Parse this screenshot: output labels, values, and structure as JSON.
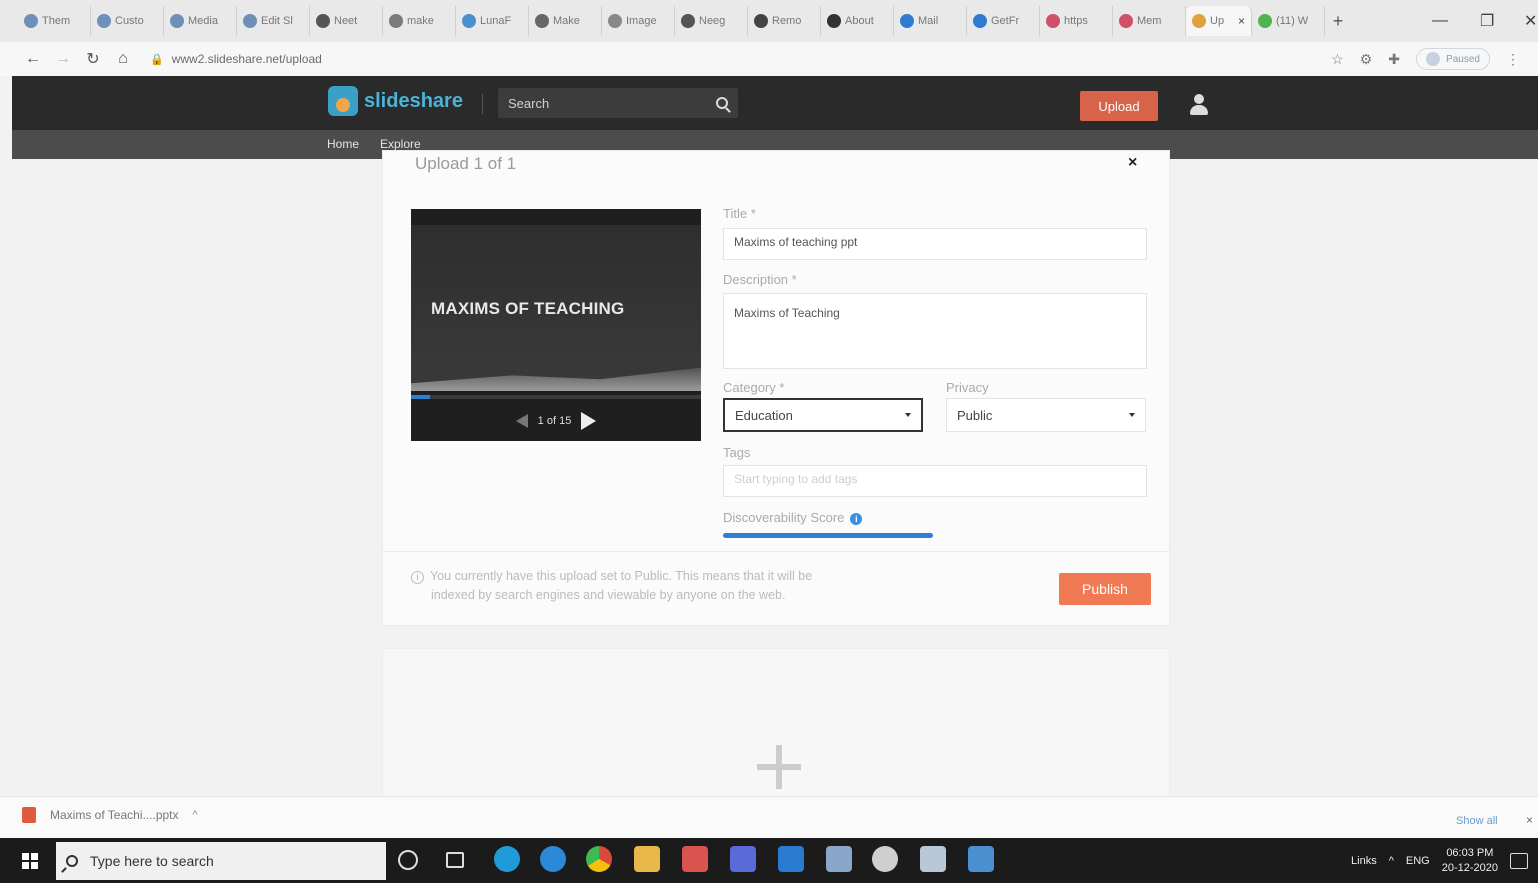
{
  "browser": {
    "tabs": [
      {
        "label": "Them",
        "icon": "wordpress-icon",
        "color": "#6d8fb8"
      },
      {
        "label": "Custo",
        "icon": "wordpress-icon",
        "color": "#6d8fb8"
      },
      {
        "label": "Media",
        "icon": "wordpress-icon",
        "color": "#6d8fb8"
      },
      {
        "label": "Edit Sl",
        "icon": "wordpress-icon",
        "color": "#6d8fb8"
      },
      {
        "label": "Neet",
        "icon": "neet-icon",
        "color": "#555555"
      },
      {
        "label": "make",
        "icon": "google-icon",
        "color": "#7a7a7a"
      },
      {
        "label": "LunaF",
        "icon": "luna-icon",
        "color": "#4a8fd0"
      },
      {
        "label": "Make",
        "icon": "wrench-icon",
        "color": "#666666"
      },
      {
        "label": "Image",
        "icon": "globe-icon",
        "color": "#888888"
      },
      {
        "label": "Neeg",
        "icon": "neet-icon",
        "color": "#555555"
      },
      {
        "label": "Remo",
        "icon": "remo-icon",
        "color": "#444444"
      },
      {
        "label": "About",
        "icon": "about-icon",
        "color": "#333333"
      },
      {
        "label": "Mail",
        "icon": "outlook-icon",
        "color": "#2f7bd0"
      },
      {
        "label": "GetFr",
        "icon": "getfr-icon",
        "color": "#2f7bd0"
      },
      {
        "label": "https",
        "icon": "https-icon",
        "color": "#d0506a"
      },
      {
        "label": "Mem",
        "icon": "mem-icon",
        "color": "#d0506a"
      },
      {
        "label": "Up",
        "icon": "slideshare-icon",
        "color": "#e0a040",
        "active": true
      },
      {
        "label": "(11) W",
        "icon": "whatsapp-icon",
        "color": "#4fb34f"
      }
    ],
    "new_tab": "+",
    "url": "www2.slideshare.net/upload",
    "profile_label": "Paused"
  },
  "site": {
    "logo_part1": "slide",
    "logo_part2": "share",
    "search_placeholder": "Search",
    "upload_label": "Upload",
    "nav": [
      "Home",
      "Explore"
    ]
  },
  "upload": {
    "title": "Upload 1 of 1",
    "close": "×",
    "preview": {
      "slide_title": "MAXIMS OF TEACHING",
      "counter": "1 of 15",
      "progress": 0.067
    },
    "form": {
      "title_label": "Title *",
      "title_value": "Maxims of teaching ppt",
      "description_label": "Description *",
      "description_value": "Maxims of Teaching",
      "category_label": "Category *",
      "category_value": "Education",
      "privacy_label": "Privacy",
      "privacy_value": "Public",
      "tags_label": "Tags",
      "tags_placeholder": "Start typing to add tags",
      "score_label": "Discoverability Score",
      "info_glyph": "i"
    },
    "notice_line1": "You currently have this upload set to Public. This means that it will be",
    "notice_line2": "indexed by search engines and viewable by anyone on the web.",
    "notice_glyph": "i",
    "publish_label": "Publish"
  },
  "download_bar": {
    "file": "Maxims of Teachi....pptx",
    "show_all": "Show all",
    "close": "×"
  },
  "taskbar": {
    "search_placeholder": "Type here to search",
    "tray_links": "Links",
    "tray_lang": "ENG",
    "time": "06:03 PM",
    "date": "20-12-2020"
  }
}
